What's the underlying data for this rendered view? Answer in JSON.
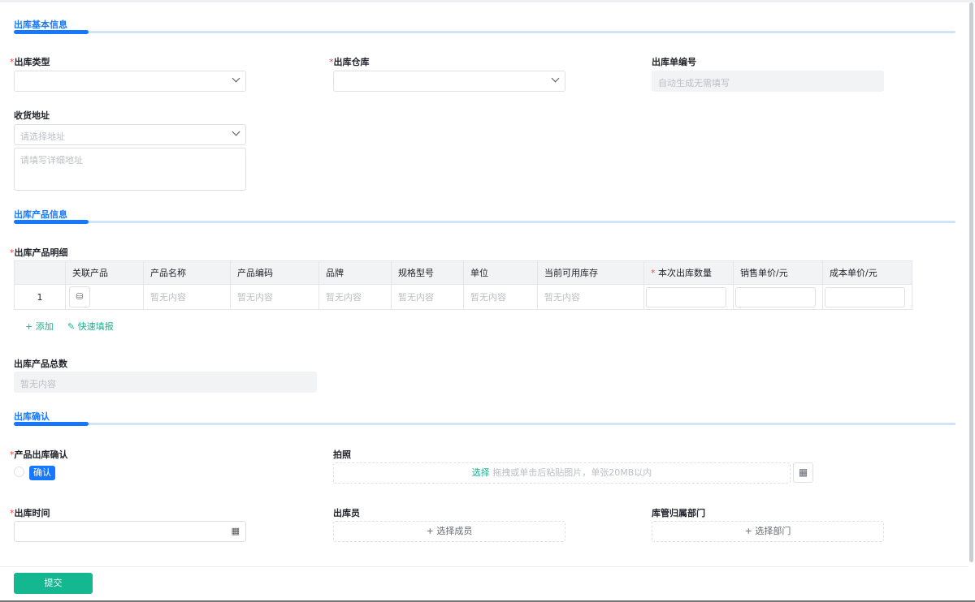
{
  "sections": {
    "basic": "出库基本信息",
    "product": "出库产品信息",
    "confirm": "出库确认"
  },
  "fields": {
    "type": {
      "label": "出库类型"
    },
    "warehouse": {
      "label": "出库仓库"
    },
    "number": {
      "label": "出库单编号",
      "placeholder": "自动生成无需填写"
    },
    "address": {
      "label": "收货地址",
      "select_placeholder": "请选择地址",
      "detail_placeholder": "请填写详细地址"
    },
    "detail": {
      "label": "出库产品明细"
    },
    "total": {
      "label": "出库产品总数",
      "value": "暂无内容"
    },
    "product_confirm": {
      "label": "产品出库确认",
      "option": "确认"
    },
    "photo": {
      "label": "拍照",
      "select": "选择",
      "hint": "拖拽或单击后粘贴图片，单张20MB以内"
    },
    "time": {
      "label": "出库时间"
    },
    "staff": {
      "label": "出库员",
      "button": "+ 选择成员"
    },
    "dept": {
      "label": "库管归属部门",
      "button": "+ 选择部门"
    }
  },
  "table": {
    "headers": [
      "",
      "关联产品",
      "产品名称",
      "产品编码",
      "品牌",
      "规格型号",
      "单位",
      "当前可用库存",
      "本次出库数量",
      "销售单价/元",
      "成本单价/元"
    ],
    "rows": [
      {
        "index": "1",
        "name": "暂无内容",
        "code": "暂无内容",
        "brand": "暂无内容",
        "model": "暂无内容",
        "unit": "暂无内容",
        "stock": "暂无内容"
      }
    ],
    "add": "+ 添加",
    "quick": "快速填报"
  },
  "required_mark": "*",
  "submit": "提交"
}
